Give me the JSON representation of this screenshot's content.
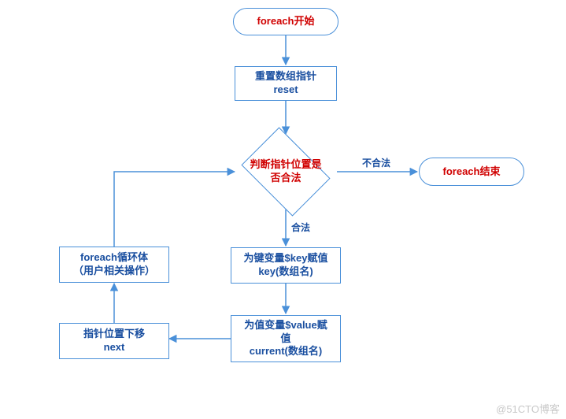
{
  "nodes": {
    "start": {
      "line1": "foreach开始"
    },
    "reset": {
      "line1": "重置数组指针",
      "line2": "reset"
    },
    "decision": {
      "line1": "判断指针位置是",
      "line2": "否合法"
    },
    "end": {
      "line1": "foreach结束"
    },
    "key": {
      "line1": "为键变量$key赋值",
      "line2": "key(数组名)"
    },
    "value": {
      "line1": "为值变量$value赋",
      "line2": "值",
      "line3": "current(数组名)"
    },
    "next": {
      "line1": "指针位置下移",
      "line2": "next"
    },
    "loop": {
      "line1": "foreach循环体",
      "line2": "（用户相关操作）"
    }
  },
  "edges": {
    "illegal": "不合法",
    "legal": "合法"
  },
  "watermark": "@51CTO博客"
}
